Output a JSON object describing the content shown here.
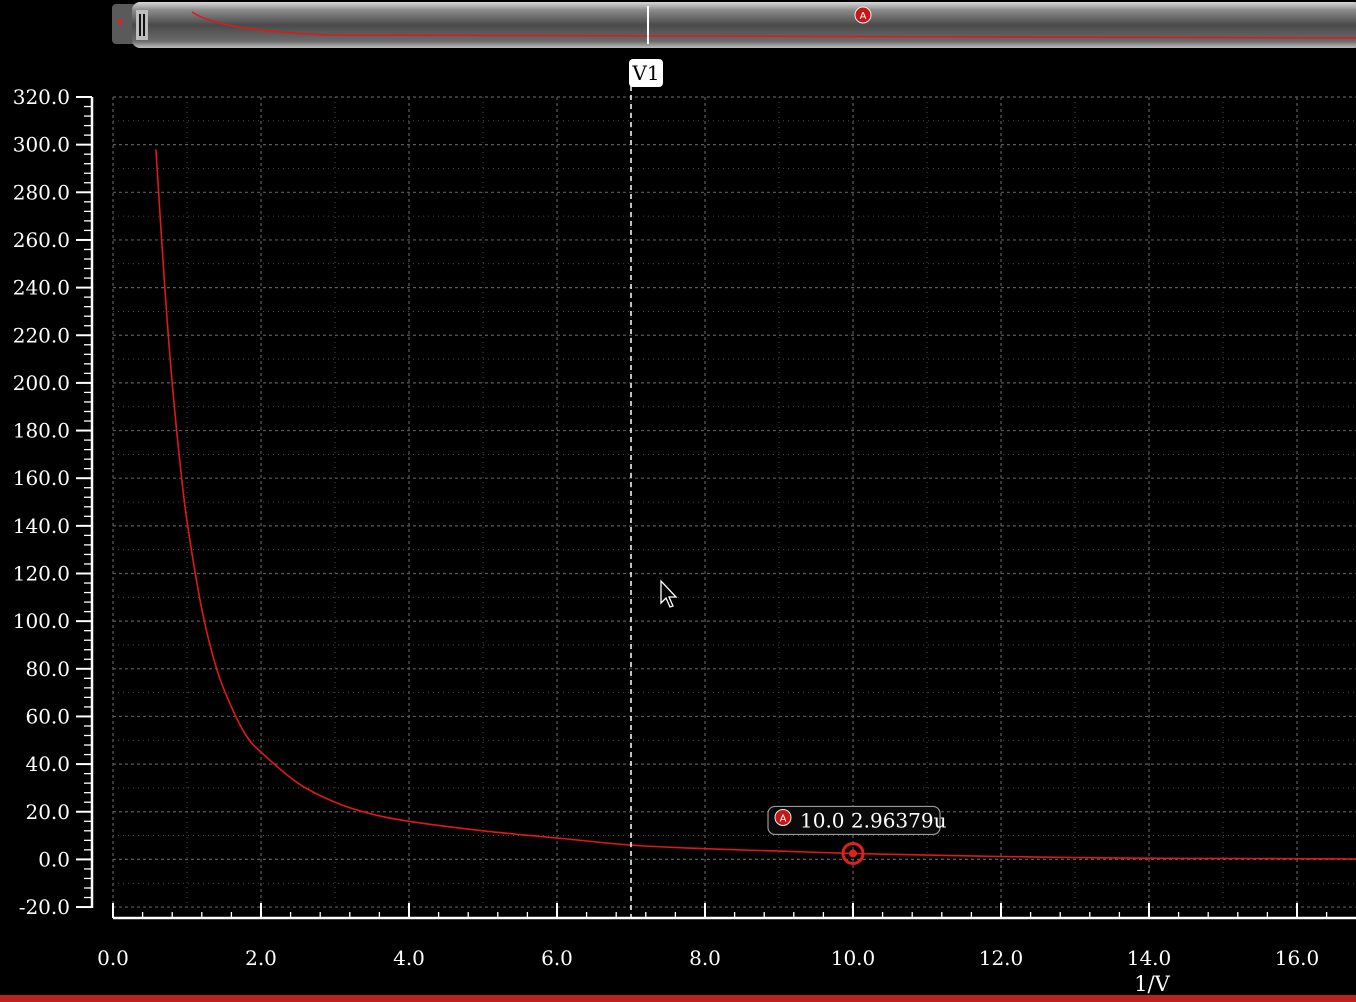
{
  "colors": {
    "background": "#000000",
    "trace": "#e01818",
    "grid": "#5a5a5a",
    "axis": "#ffffff",
    "marker": "#d42020"
  },
  "overview": {
    "marker_label": "A"
  },
  "cursor": {
    "label": "V1",
    "x": 7.0
  },
  "marker": {
    "label": "A",
    "x": 10.0,
    "y": 2.96379e-06,
    "readout": "10.0 2.96379u"
  },
  "cursor_icon": "arrow-pointer-icon",
  "chart_data": {
    "type": "line",
    "xlabel": "1/V",
    "ylabel": "",
    "xlim": [
      0,
      16.8
    ],
    "ylim": [
      -20,
      320
    ],
    "xticks": [
      "0.0",
      "2.0",
      "4.0",
      "6.0",
      "8.0",
      "10.0",
      "12.0",
      "14.0",
      "16.0"
    ],
    "yticks": [
      "320.0",
      "300.0",
      "280.0",
      "260.0",
      "240.0",
      "220.0",
      "200.0",
      "180.0",
      "160.0",
      "140.0",
      "120.0",
      "100.0",
      "80.0",
      "60.0",
      "40.0",
      "20.0",
      "0.0",
      "-20.0"
    ],
    "grid": true,
    "series": [
      {
        "x": [
          0.58,
          0.7,
          0.8,
          0.9,
          1.0,
          1.2,
          1.4,
          1.6,
          1.8,
          2.0,
          2.5,
          3.0,
          3.5,
          4.0,
          5.0,
          6.0,
          7.0,
          8.0,
          9.0,
          10.0,
          11.0,
          12.0,
          13.0,
          14.0,
          15.0,
          16.0,
          16.8
        ],
        "y": [
          298,
          240,
          200,
          168,
          142,
          105,
          80,
          64,
          52,
          45,
          32,
          24,
          19,
          16,
          12,
          9,
          6,
          4.5,
          3.5,
          2.5,
          1.8,
          1.2,
          0.8,
          0.5,
          0.4,
          0.3,
          0.2
        ]
      }
    ]
  }
}
